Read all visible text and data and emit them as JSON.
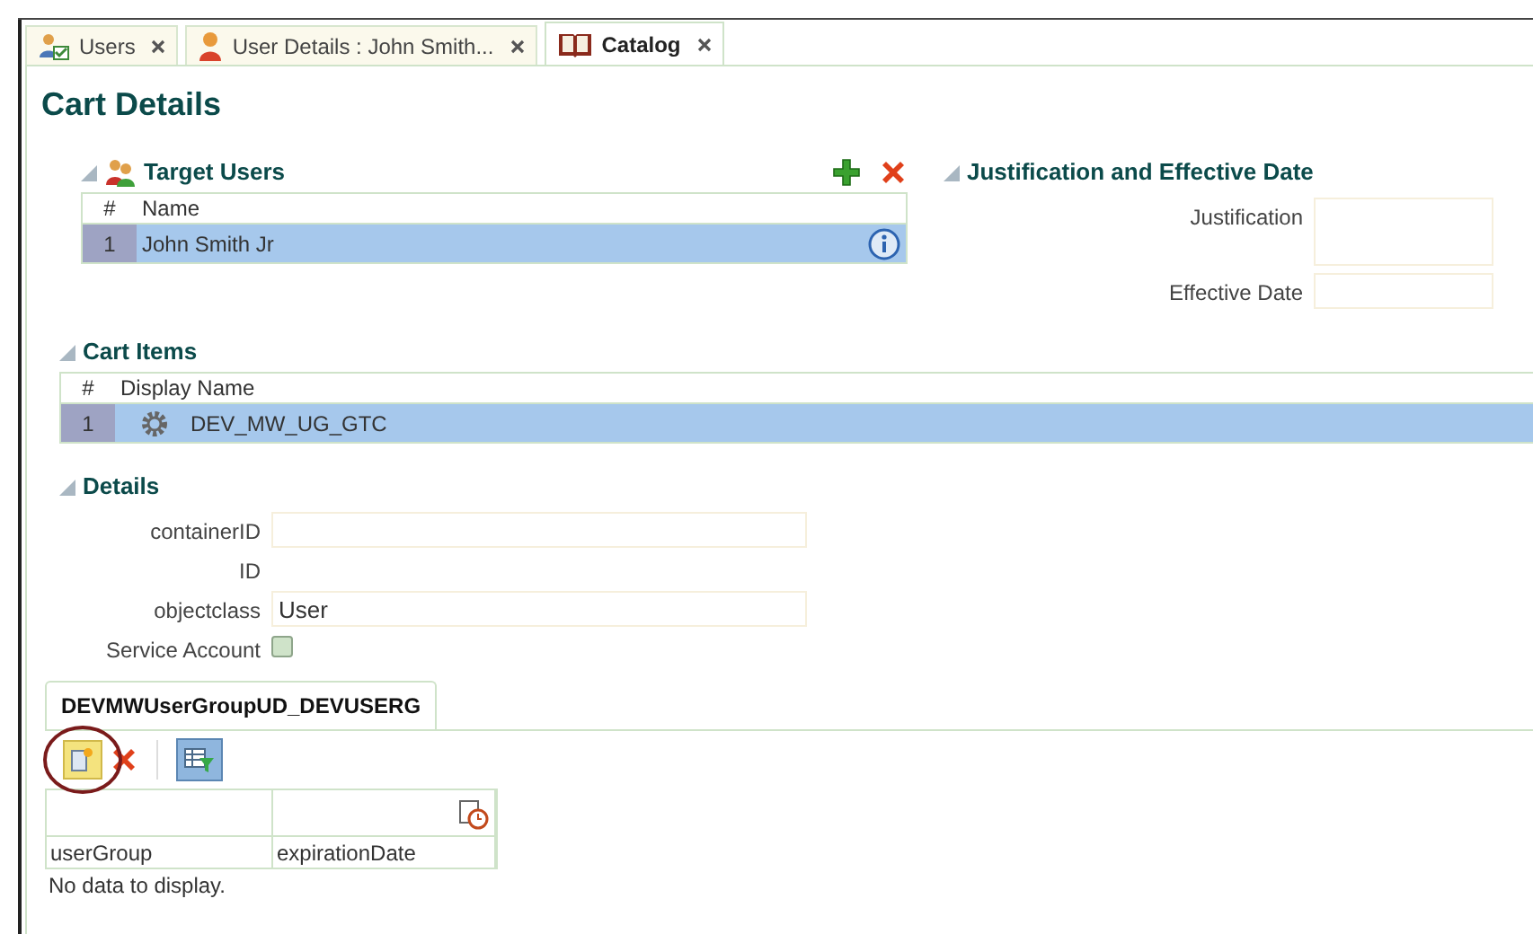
{
  "tabs": [
    {
      "label": "Users",
      "selected": false
    },
    {
      "label": "User Details : John Smith...",
      "selected": false
    },
    {
      "label": "Catalog",
      "selected": true
    }
  ],
  "page_title": "Cart Details",
  "target_users": {
    "title": "Target Users",
    "columns": [
      "#",
      "Name"
    ],
    "rows": [
      {
        "index": "1",
        "name": "John Smith Jr",
        "selected": true
      }
    ]
  },
  "justification": {
    "title": "Justification and Effective Date",
    "fields": [
      {
        "label": "Justification",
        "kind": "textarea"
      },
      {
        "label": "Effective Date",
        "kind": "input"
      }
    ]
  },
  "cart_items": {
    "title": "Cart Items",
    "columns": [
      "#",
      "Display Name"
    ],
    "rows": [
      {
        "index": "1",
        "name": "DEV_MW_UG_GTC",
        "selected": true
      }
    ]
  },
  "details": {
    "title": "Details",
    "fields": [
      {
        "label": "containerID",
        "kind": "input"
      },
      {
        "label": "ID",
        "kind": "text"
      },
      {
        "label": "objectclass",
        "value": "User",
        "kind": "input"
      },
      {
        "label": "Service Account",
        "checked": false,
        "kind": "checkbox"
      }
    ]
  },
  "subtab": {
    "label": "DEVMWUserGroupUD_DEVUSERG",
    "selected": true
  },
  "child_table": {
    "columns": [
      "userGroup",
      "expirationDate"
    ],
    "empty_text": "No data to display."
  }
}
